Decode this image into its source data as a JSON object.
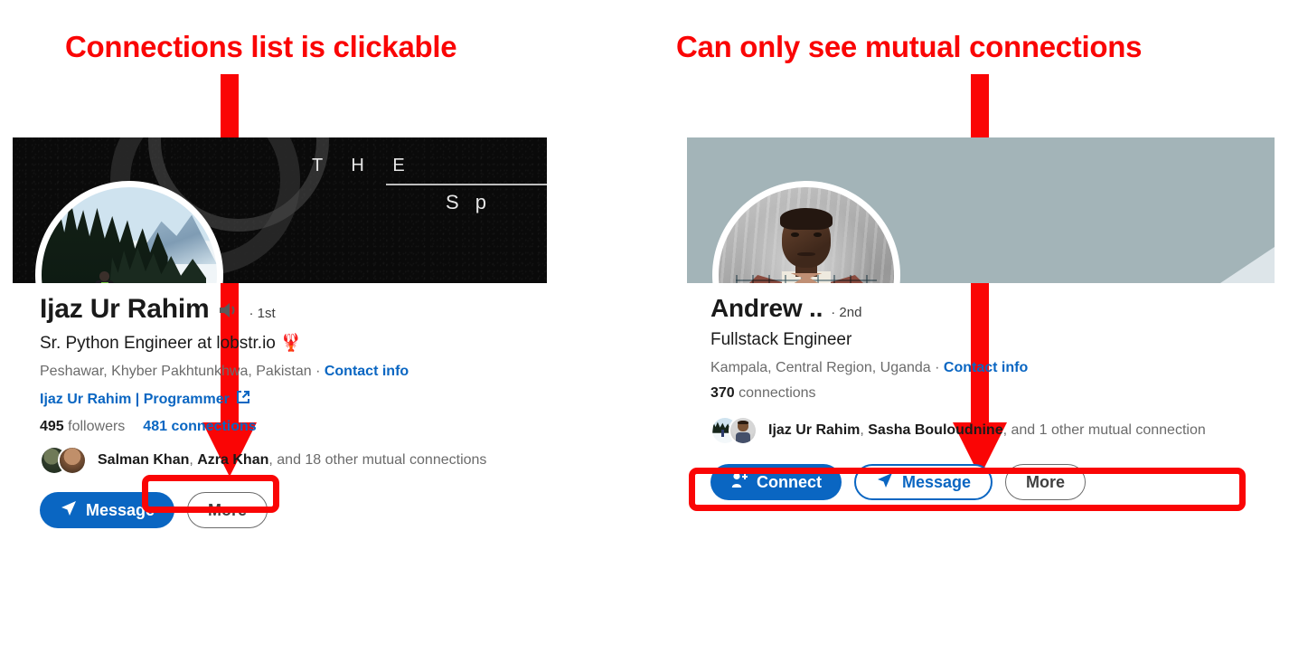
{
  "annotations": {
    "left": "Connections list is clickable",
    "right": "Can only see mutual connections",
    "accent_color": "#fa0505"
  },
  "profiles": {
    "left": {
      "banner": {
        "line1": "T H E",
        "line2": "S p",
        "background_color": "#0a0a0a"
      },
      "avatar_name": "snowy-forest-portrait",
      "name": "Ijaz Ur Rahim",
      "audio_icon": "speaker-icon",
      "degree": "· 1st",
      "headline": "Sr. Python Engineer at lobstr.io 🦞",
      "location": "Peshawar, Khyber Pakhtunkhwa, Pakistan",
      "location_separator": " · ",
      "contact_info": "Contact info",
      "website_link": "Ijaz Ur Rahim | Programmer",
      "external_icon": "external-link-icon",
      "followers_count": "495",
      "followers_label": "followers",
      "connections": "481 connections",
      "mutual_names": "Salman Khan, Azra Khan",
      "mutual_name_1": "Salman Khan",
      "mutual_name_2": "Azra Khan",
      "mutual_rest": ", and 18 other mutual connections",
      "buttons": {
        "message": "Message",
        "more": "More"
      }
    },
    "right": {
      "banner": {
        "background_color": "#a3b4b8"
      },
      "avatar_name": "man-in-patterned-suit-portrait",
      "name": "Andrew ..",
      "degree": "· 2nd",
      "headline": "Fullstack Engineer",
      "location": "Kampala, Central Region, Uganda",
      "location_separator": " · ",
      "contact_info": "Contact info",
      "connections_count": "370",
      "connections_label": "connections",
      "mutual_name_1": "Ijaz Ur Rahim",
      "mutual_sep": ", ",
      "mutual_name_2": "Sasha Bouloudnine",
      "mutual_rest": ", and 1 other mutual connection",
      "buttons": {
        "connect": "Connect",
        "message": "Message",
        "more": "More"
      }
    }
  },
  "colors": {
    "linkedin_blue": "#0a66c2",
    "annotation_red": "#fa0505",
    "text_dark": "#1a1a1a",
    "text_muted": "#6b6b6b"
  }
}
